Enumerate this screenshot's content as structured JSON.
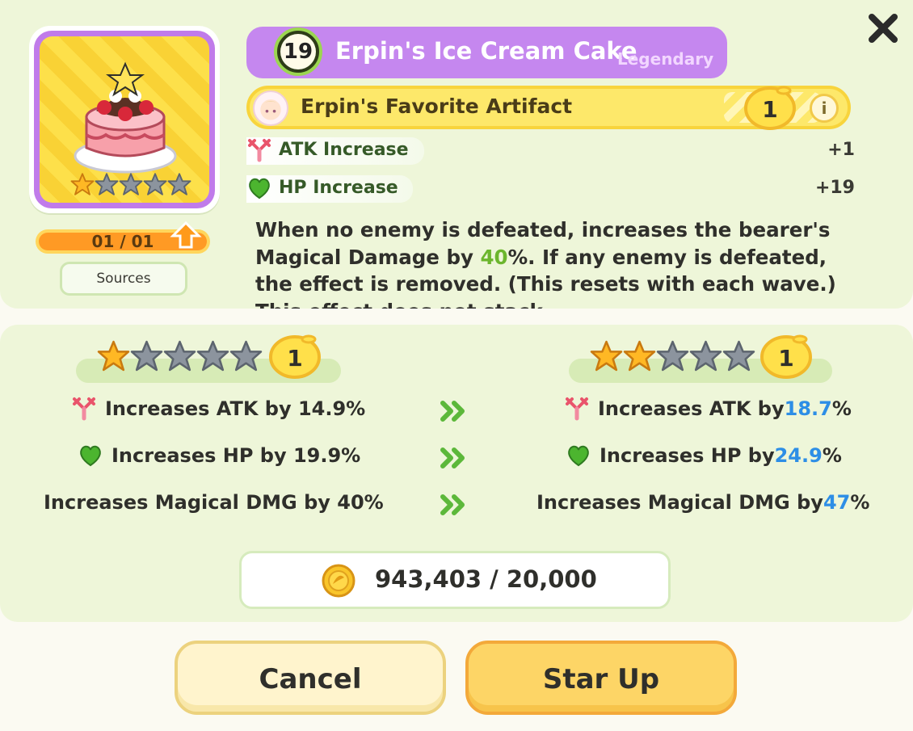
{
  "artifact": {
    "level": "19",
    "name": "Erpin's Ice Cream Cake",
    "rarity": "Legendary",
    "card_star_count": 1,
    "card_star_total": 5,
    "copies": "01 / 01",
    "sources_label": "Sources"
  },
  "favorite": {
    "text": "Erpin's Favorite Artifact",
    "lemon_value": "1",
    "info_label": "i"
  },
  "stats": [
    {
      "label": "ATK Increase",
      "value": "+1",
      "icon": "atk-icon"
    },
    {
      "label": "HP Increase",
      "value": "+19",
      "icon": "hp-heart-icon"
    }
  ],
  "description": {
    "p1": "When no enemy is defeated, increases the bearer's Magical Damage by ",
    "hl": "40",
    "p2": "%. If any enemy is defeated, the effect is removed. (This resets with each wave.) This effect does not stack"
  },
  "compare": {
    "current": {
      "stars": 1,
      "lemon": "1",
      "lines": [
        {
          "text": "Increases ATK by 14.9%"
        },
        {
          "text": "Increases HP by 19.9%"
        },
        {
          "text": "Increases Magical DMG by 40%"
        }
      ]
    },
    "next": {
      "stars": 2,
      "lemon": "1",
      "lines": [
        {
          "pre": "Increases ATK by ",
          "num": "18.7",
          "post": "%"
        },
        {
          "pre": "Increases HP by ",
          "num": "24.9",
          "post": "%"
        },
        {
          "pre": "Increases Magical DMG by ",
          "num": "47",
          "post": "%"
        }
      ]
    }
  },
  "cost": "943,403 / 20,000",
  "buttons": {
    "cancel": "Cancel",
    "star_up": "Star Up"
  },
  "colors": {
    "accent_purple": "#c587ef",
    "highlight_green": "#6cb62d",
    "highlight_blue": "#2d8ee6",
    "gold": "#fdd566"
  }
}
